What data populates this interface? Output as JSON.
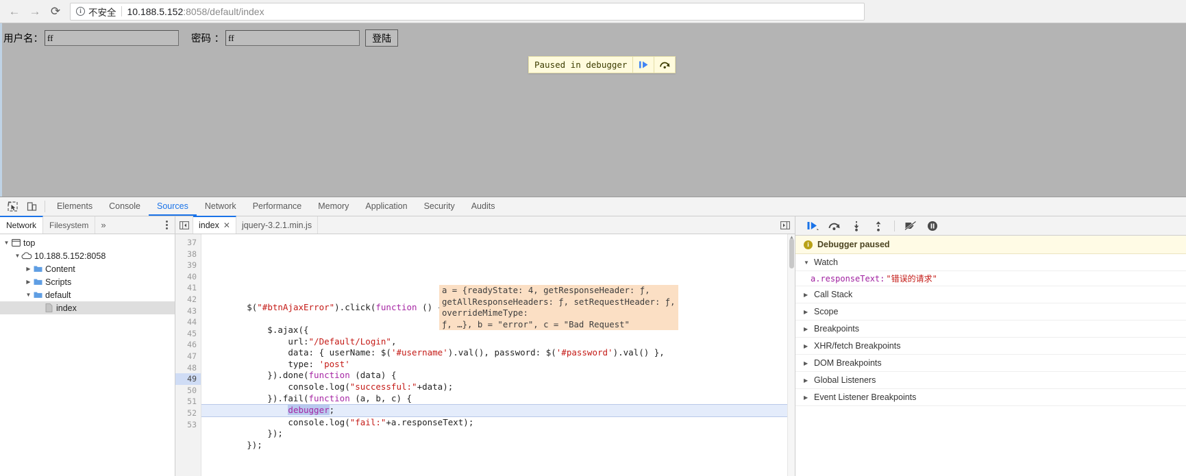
{
  "browser": {
    "back_icon": "arrow-left-icon",
    "forward_icon": "arrow-right-icon",
    "reload_icon": "reload-icon",
    "security_label": "不安全",
    "url_host": "10.188.5.152",
    "url_rest": ":8058/default/index",
    "url_full": "10.188.5.152:8058/default/index"
  },
  "page": {
    "username_label": "用户名：",
    "username_value": "ff",
    "password_label": "密码 ：",
    "password_value": "ff",
    "login_button": "登陆",
    "paused_banner": {
      "text": "Paused in debugger",
      "resume_icon": "resume-script-icon",
      "step_over_icon": "step-over-icon"
    }
  },
  "devtools": {
    "inspect_icon": "inspect-element-icon",
    "device_icon": "device-toolbar-icon",
    "tabs": [
      {
        "label": "Elements",
        "active": false
      },
      {
        "label": "Console",
        "active": false
      },
      {
        "label": "Sources",
        "active": true
      },
      {
        "label": "Network",
        "active": false
      },
      {
        "label": "Performance",
        "active": false
      },
      {
        "label": "Memory",
        "active": false
      },
      {
        "label": "Application",
        "active": false
      },
      {
        "label": "Security",
        "active": false
      },
      {
        "label": "Audits",
        "active": false
      }
    ],
    "navigator": {
      "tabs": [
        {
          "label": "Network",
          "active": true
        },
        {
          "label": "Filesystem",
          "active": false
        }
      ],
      "more_label": "»",
      "kebab_icon": "more-options-icon",
      "tree": [
        {
          "label": "top",
          "depth": 0,
          "twisty": "▼",
          "icon": "frame-icon",
          "selected": false
        },
        {
          "label": "10.188.5.152:8058",
          "depth": 1,
          "twisty": "▼",
          "icon": "cloud-icon",
          "selected": false
        },
        {
          "label": "Content",
          "depth": 2,
          "twisty": "▶",
          "icon": "folder-icon",
          "selected": false
        },
        {
          "label": "Scripts",
          "depth": 2,
          "twisty": "▶",
          "icon": "folder-icon",
          "selected": false
        },
        {
          "label": "default",
          "depth": 2,
          "twisty": "▼",
          "icon": "folder-icon",
          "selected": false
        },
        {
          "label": "index",
          "depth": 3,
          "twisty": "",
          "icon": "document-icon",
          "selected": true
        }
      ]
    },
    "editor": {
      "panel_toggle_icon": "show-navigator-icon",
      "expand_icon": "show-debugger-icon",
      "tabs": [
        {
          "label": "index",
          "active": true,
          "close_glyph": "✕"
        },
        {
          "label": "jquery-3.2.1.min.js",
          "active": false
        }
      ],
      "first_line_number": 37,
      "lines": [
        {
          "n": 37,
          "text": ""
        },
        {
          "n": 38,
          "text": ""
        },
        {
          "n": 39,
          "text": ""
        },
        {
          "n": 40,
          "text": "        $(\"#btnAjaxError\").click(function () {"
        },
        {
          "n": 41,
          "text": ""
        },
        {
          "n": 42,
          "text": "            $.ajax({"
        },
        {
          "n": 43,
          "text": "                url:\"/Default/Login\","
        },
        {
          "n": 44,
          "text": "                data: { userName: $('#username').val(), password: $('#password').val() },"
        },
        {
          "n": 45,
          "text": "                type: 'post'"
        },
        {
          "n": 46,
          "text": "            }).done(function (data) {"
        },
        {
          "n": 47,
          "text": "                console.log(\"successful:\"+data);"
        },
        {
          "n": 48,
          "text": "            }).fail(function (a, b, c) {"
        },
        {
          "n": 49,
          "text": "                    debugger;",
          "current": true
        },
        {
          "n": 50,
          "text": "                console.log(\"fail:\"+a.responseText);"
        },
        {
          "n": 51,
          "text": "            });"
        },
        {
          "n": 52,
          "text": "        });"
        },
        {
          "n": 53,
          "text": ""
        }
      ],
      "inline_evaluation": [
        "a = {readyState: 4, getResponseHeader: ƒ,",
        "getAllResponseHeaders: ƒ, setRequestHeader: ƒ,",
        "overrideMimeType:",
        "ƒ, …}, b = \"error\", c = \"Bad Request\""
      ]
    },
    "debugger": {
      "toolbar": [
        {
          "name": "resume-script-execution",
          "title": "Resume script execution"
        },
        {
          "name": "step-over-next-function-call",
          "title": "Step over next function call"
        },
        {
          "name": "step-into-next-function-call",
          "title": "Step into next function call"
        },
        {
          "name": "step-out-of-current-function",
          "title": "Step out of current function"
        },
        {
          "name": "deactivate-breakpoints",
          "title": "Deactivate breakpoints"
        },
        {
          "name": "pause-on-exceptions",
          "title": "Pause on exceptions"
        }
      ],
      "status_text": "Debugger paused",
      "watch": {
        "title": "Watch",
        "expanded": true,
        "entries": [
          {
            "key": "a.responseText:",
            "value": "\"错误的请求\""
          }
        ]
      },
      "sections": [
        {
          "label": "Call Stack",
          "expanded": false
        },
        {
          "label": "Scope",
          "expanded": false
        },
        {
          "label": "Breakpoints",
          "expanded": false
        },
        {
          "label": "XHR/fetch Breakpoints",
          "expanded": false
        },
        {
          "label": "DOM Breakpoints",
          "expanded": false
        },
        {
          "label": "Global Listeners",
          "expanded": false
        },
        {
          "label": "Event Listener Breakpoints",
          "expanded": false
        }
      ]
    }
  },
  "colors": {
    "accent": "#1a73e8",
    "paused_bg": "#fffbdd",
    "status_bg": "#fffbe5",
    "eval_bg": "#fbdfc4",
    "current_line": "#e4ecfb"
  }
}
